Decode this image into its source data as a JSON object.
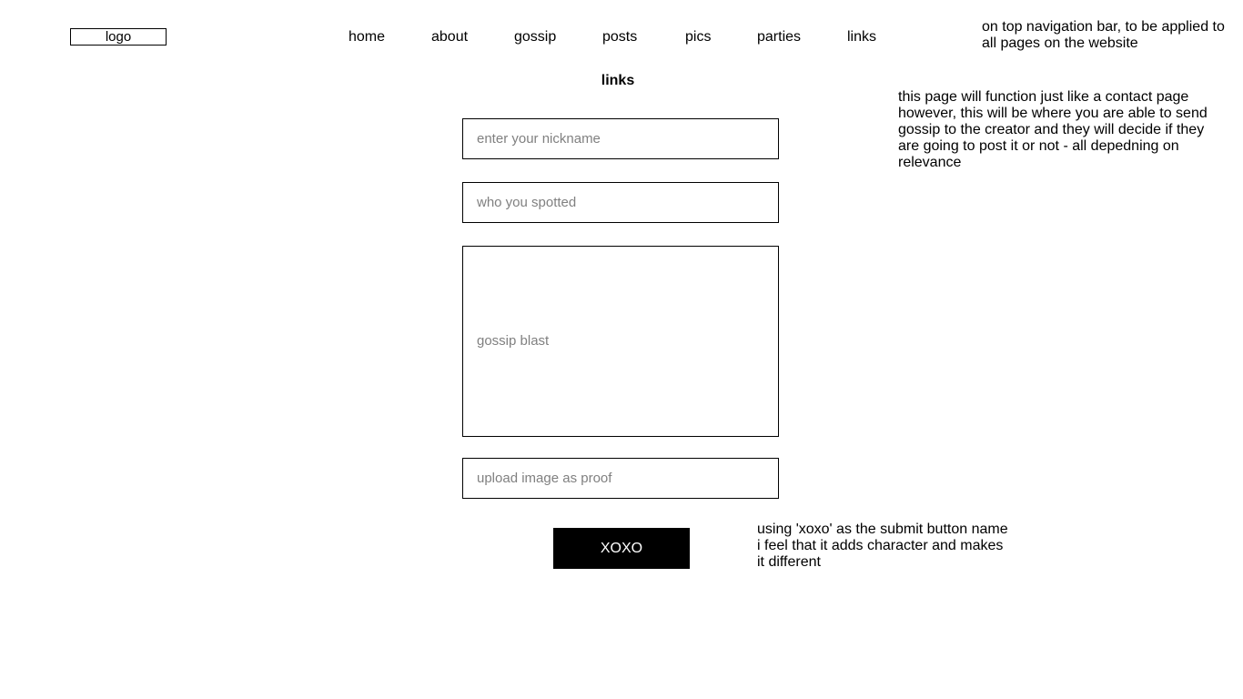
{
  "header": {
    "logo_label": "logo",
    "nav": [
      {
        "label": "home"
      },
      {
        "label": "about"
      },
      {
        "label": "gossip"
      },
      {
        "label": "posts"
      },
      {
        "label": "pics"
      },
      {
        "label": "parties"
      },
      {
        "label": "links"
      }
    ]
  },
  "notes": {
    "nav_note": [
      "on top navigation bar, to be applied to",
      "all pages on the website"
    ],
    "page_note": [
      "this page will function just like a contact page",
      "however, this will be where you are able to send",
      "gossip to the creator and they will decide if they",
      "are going to post it or not - all depedning on",
      "relevance"
    ],
    "button_note": [
      "using 'xoxo' as the submit button name",
      "i feel that it adds character and makes",
      "it different"
    ]
  },
  "main": {
    "page_title": "links",
    "form": {
      "nickname_placeholder": "enter your nickname",
      "spotted_placeholder": "who you spotted",
      "gossip_placeholder": "gossip blast",
      "upload_placeholder": "upload image as proof",
      "submit_label": "XOXO"
    }
  }
}
